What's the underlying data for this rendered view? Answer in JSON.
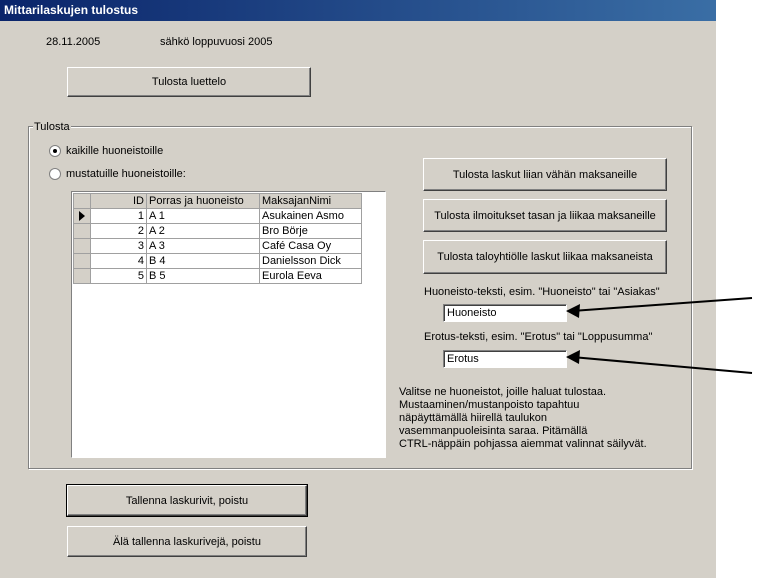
{
  "window": {
    "title": "Mittarilaskujen tulostus"
  },
  "header": {
    "date": "28.11.2005",
    "subtitle": "sähkö loppuvuosi 2005"
  },
  "buttons": {
    "print_list": "Tulosta luettelo",
    "print_underpaid": "Tulosta laskut liian vähän maksaneille",
    "print_notices": "Tulosta ilmoitukset tasan ja liikaa maksaneille",
    "print_association": "Tulosta taloyhtiölle laskut liikaa maksaneista",
    "save_exit": "Tallenna laskurivit, poistu",
    "nosave_exit": "Älä tallenna laskurivejä, poistu"
  },
  "group": {
    "label": "Tulosta",
    "radio_all": "kaikille huoneistoille",
    "radio_marked": "mustatuille huoneistoille:",
    "selected": "all"
  },
  "table": {
    "headers": [
      "ID",
      "Porras ja huoneisto",
      "MaksajanNimi"
    ],
    "rows": [
      {
        "id": "1",
        "apartment": "A 1",
        "payer": "Asukainen Asmo",
        "current": true
      },
      {
        "id": "2",
        "apartment": "A 2",
        "payer": "Bro Börje",
        "current": false
      },
      {
        "id": "3",
        "apartment": "A 3",
        "payer": "Café Casa Oy",
        "current": false
      },
      {
        "id": "4",
        "apartment": "B 4",
        "payer": "Danielsson Dick",
        "current": false
      },
      {
        "id": "5",
        "apartment": "B 5",
        "payer": "Eurola Eeva",
        "current": false
      }
    ]
  },
  "fields": {
    "room_label": "Huoneisto-teksti, esim. \"Huoneisto\" tai \"Asiakas\"",
    "room_value": "Huoneisto",
    "diff_label": "Erotus-teksti, esim. \"Erotus\" tai \"Loppusumma\"",
    "diff_value": "Erotus"
  },
  "help": {
    "lines": [
      "Valitse ne huoneistot, joille haluat tulostaa.",
      "Mustaaminen/mustanpoisto tapahtuu",
      "näpäyttämällä hiirellä taulukon",
      "vasemmanpuoleisinta saraa. Pitämällä",
      "CTRL-näppäin pohjassa aiemmat valinnat säilyvät."
    ]
  },
  "colors": {
    "titlebar_start": "#0a246a",
    "titlebar_end": "#3a6ea5",
    "face": "#d4d0c8"
  }
}
